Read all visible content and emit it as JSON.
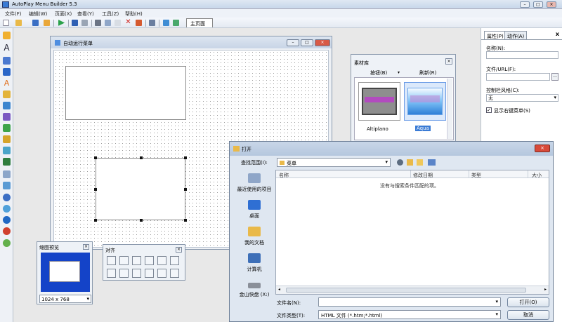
{
  "app": {
    "title": "AutoPlay Menu Builder 5.3"
  },
  "menu": [
    "文件(F)",
    "编辑(W)",
    "页面(X)",
    "查看(Y)",
    "工具(Z)",
    "帮助(H)"
  ],
  "tabs": {
    "main_page": "主页面"
  },
  "design_window": {
    "title": "自动运行菜单"
  },
  "material_library": {
    "title": "素材库",
    "buttons_dropdown": "按钮(B)",
    "refresh": "刷新(R)",
    "items": [
      "Altiplano",
      "Aqua"
    ],
    "selected": "Aqua"
  },
  "properties": {
    "tab_properties": "属性(P)",
    "tab_actions": "动作(A)",
    "name_label": "名称(N):",
    "file_url_label": "文件/URL(F):",
    "control_style_label": "控制栏风格(C):",
    "control_style_value": "无",
    "show_context_menu": "显示右键菜单(S)",
    "show_context_menu_checked": true
  },
  "preview_panel": {
    "title": "缩图预览",
    "resolution": "1024 x 768"
  },
  "align_panel": {
    "title": "对齐"
  },
  "open_dialog": {
    "title": "打开",
    "lookin_label": "查找范围(I):",
    "lookin_value": "菜单",
    "places": [
      "最近使用的项目",
      "桌面",
      "我的文档",
      "计算机",
      "金山快盘 (X:)"
    ],
    "columns": [
      "名称",
      "修改日期",
      "类型",
      "大小"
    ],
    "empty_message": "没有与搜索条件匹配的项。",
    "filename_label": "文件名(N):",
    "filename_value": "",
    "filetype_label": "文件类型(T):",
    "filetype_value": "HTML 文件 (*.htm;*.html)",
    "open_button": "打开(O)",
    "cancel_button": "取消"
  },
  "colors": {
    "accent": "#3a7bd5",
    "preview_blue": "#1443c8",
    "close_red": "#d84a3a"
  }
}
